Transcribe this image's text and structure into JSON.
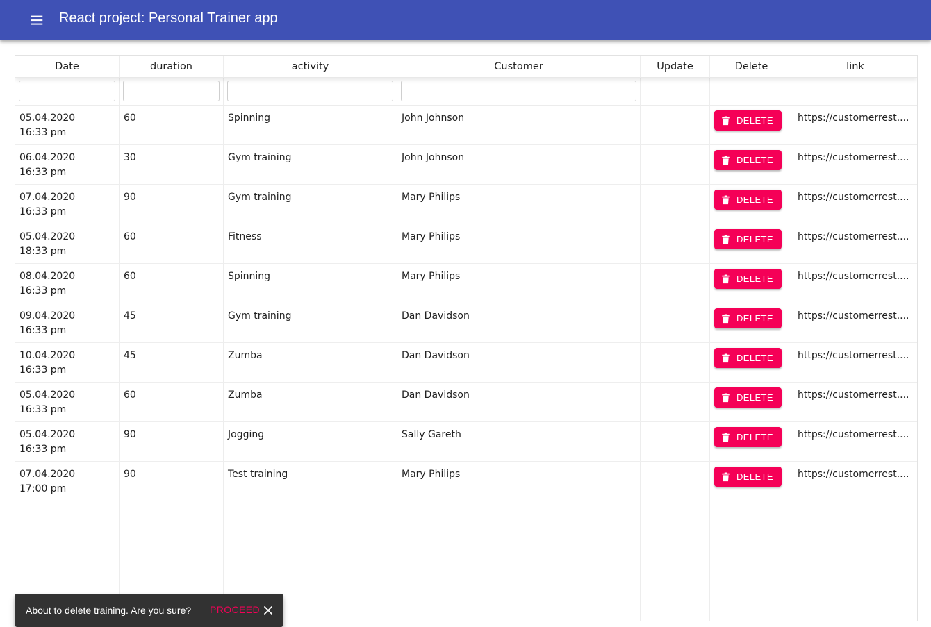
{
  "appbar": {
    "title": "React project: Personal Trainer app",
    "menu_icon": "menu-icon",
    "color": "#3f51b5"
  },
  "grid": {
    "columns": [
      "Date",
      "duration",
      "activity",
      "Customer",
      "Update",
      "Delete",
      "link"
    ],
    "filters": {
      "date": "",
      "duration": "",
      "activity": "",
      "customer": ""
    },
    "delete_label": "DELETE",
    "delete_icon": "trash-icon",
    "delete_color": "#f50057",
    "rows": [
      {
        "date": "05.04.2020",
        "time": "16:33 pm",
        "duration": "60",
        "activity": "Spinning",
        "customer": "John Johnson",
        "link": "https://customerrest...."
      },
      {
        "date": "06.04.2020",
        "time": "16:33 pm",
        "duration": "30",
        "activity": "Gym training",
        "customer": "John Johnson",
        "link": "https://customerrest...."
      },
      {
        "date": "07.04.2020",
        "time": "16:33 pm",
        "duration": "90",
        "activity": "Gym training",
        "customer": "Mary Philips",
        "link": "https://customerrest...."
      },
      {
        "date": "05.04.2020",
        "time": "18:33 pm",
        "duration": "60",
        "activity": "Fitness",
        "customer": "Mary Philips",
        "link": "https://customerrest...."
      },
      {
        "date": "08.04.2020",
        "time": "16:33 pm",
        "duration": "60",
        "activity": "Spinning",
        "customer": "Mary Philips",
        "link": "https://customerrest...."
      },
      {
        "date": "09.04.2020",
        "time": "16:33 pm",
        "duration": "45",
        "activity": "Gym training",
        "customer": "Dan Davidson",
        "link": "https://customerrest...."
      },
      {
        "date": "10.04.2020",
        "time": "16:33 pm",
        "duration": "45",
        "activity": "Zumba",
        "customer": "Dan Davidson",
        "link": "https://customerrest...."
      },
      {
        "date": "05.04.2020",
        "time": "16:33 pm",
        "duration": "60",
        "activity": "Zumba",
        "customer": "Dan Davidson",
        "link": "https://customerrest...."
      },
      {
        "date": "05.04.2020",
        "time": "16:33 pm",
        "duration": "90",
        "activity": "Jogging",
        "customer": "Sally Gareth",
        "link": "https://customerrest...."
      },
      {
        "date": "07.04.2020",
        "time": "17:00 pm",
        "duration": "90",
        "activity": "Test training",
        "customer": "Mary Philips",
        "link": "https://customerrest...."
      }
    ]
  },
  "snackbar": {
    "message": "About to delete training. Are you sure?",
    "action": "PROCEED",
    "close_icon": "close-icon",
    "action_color": "#f50057"
  }
}
